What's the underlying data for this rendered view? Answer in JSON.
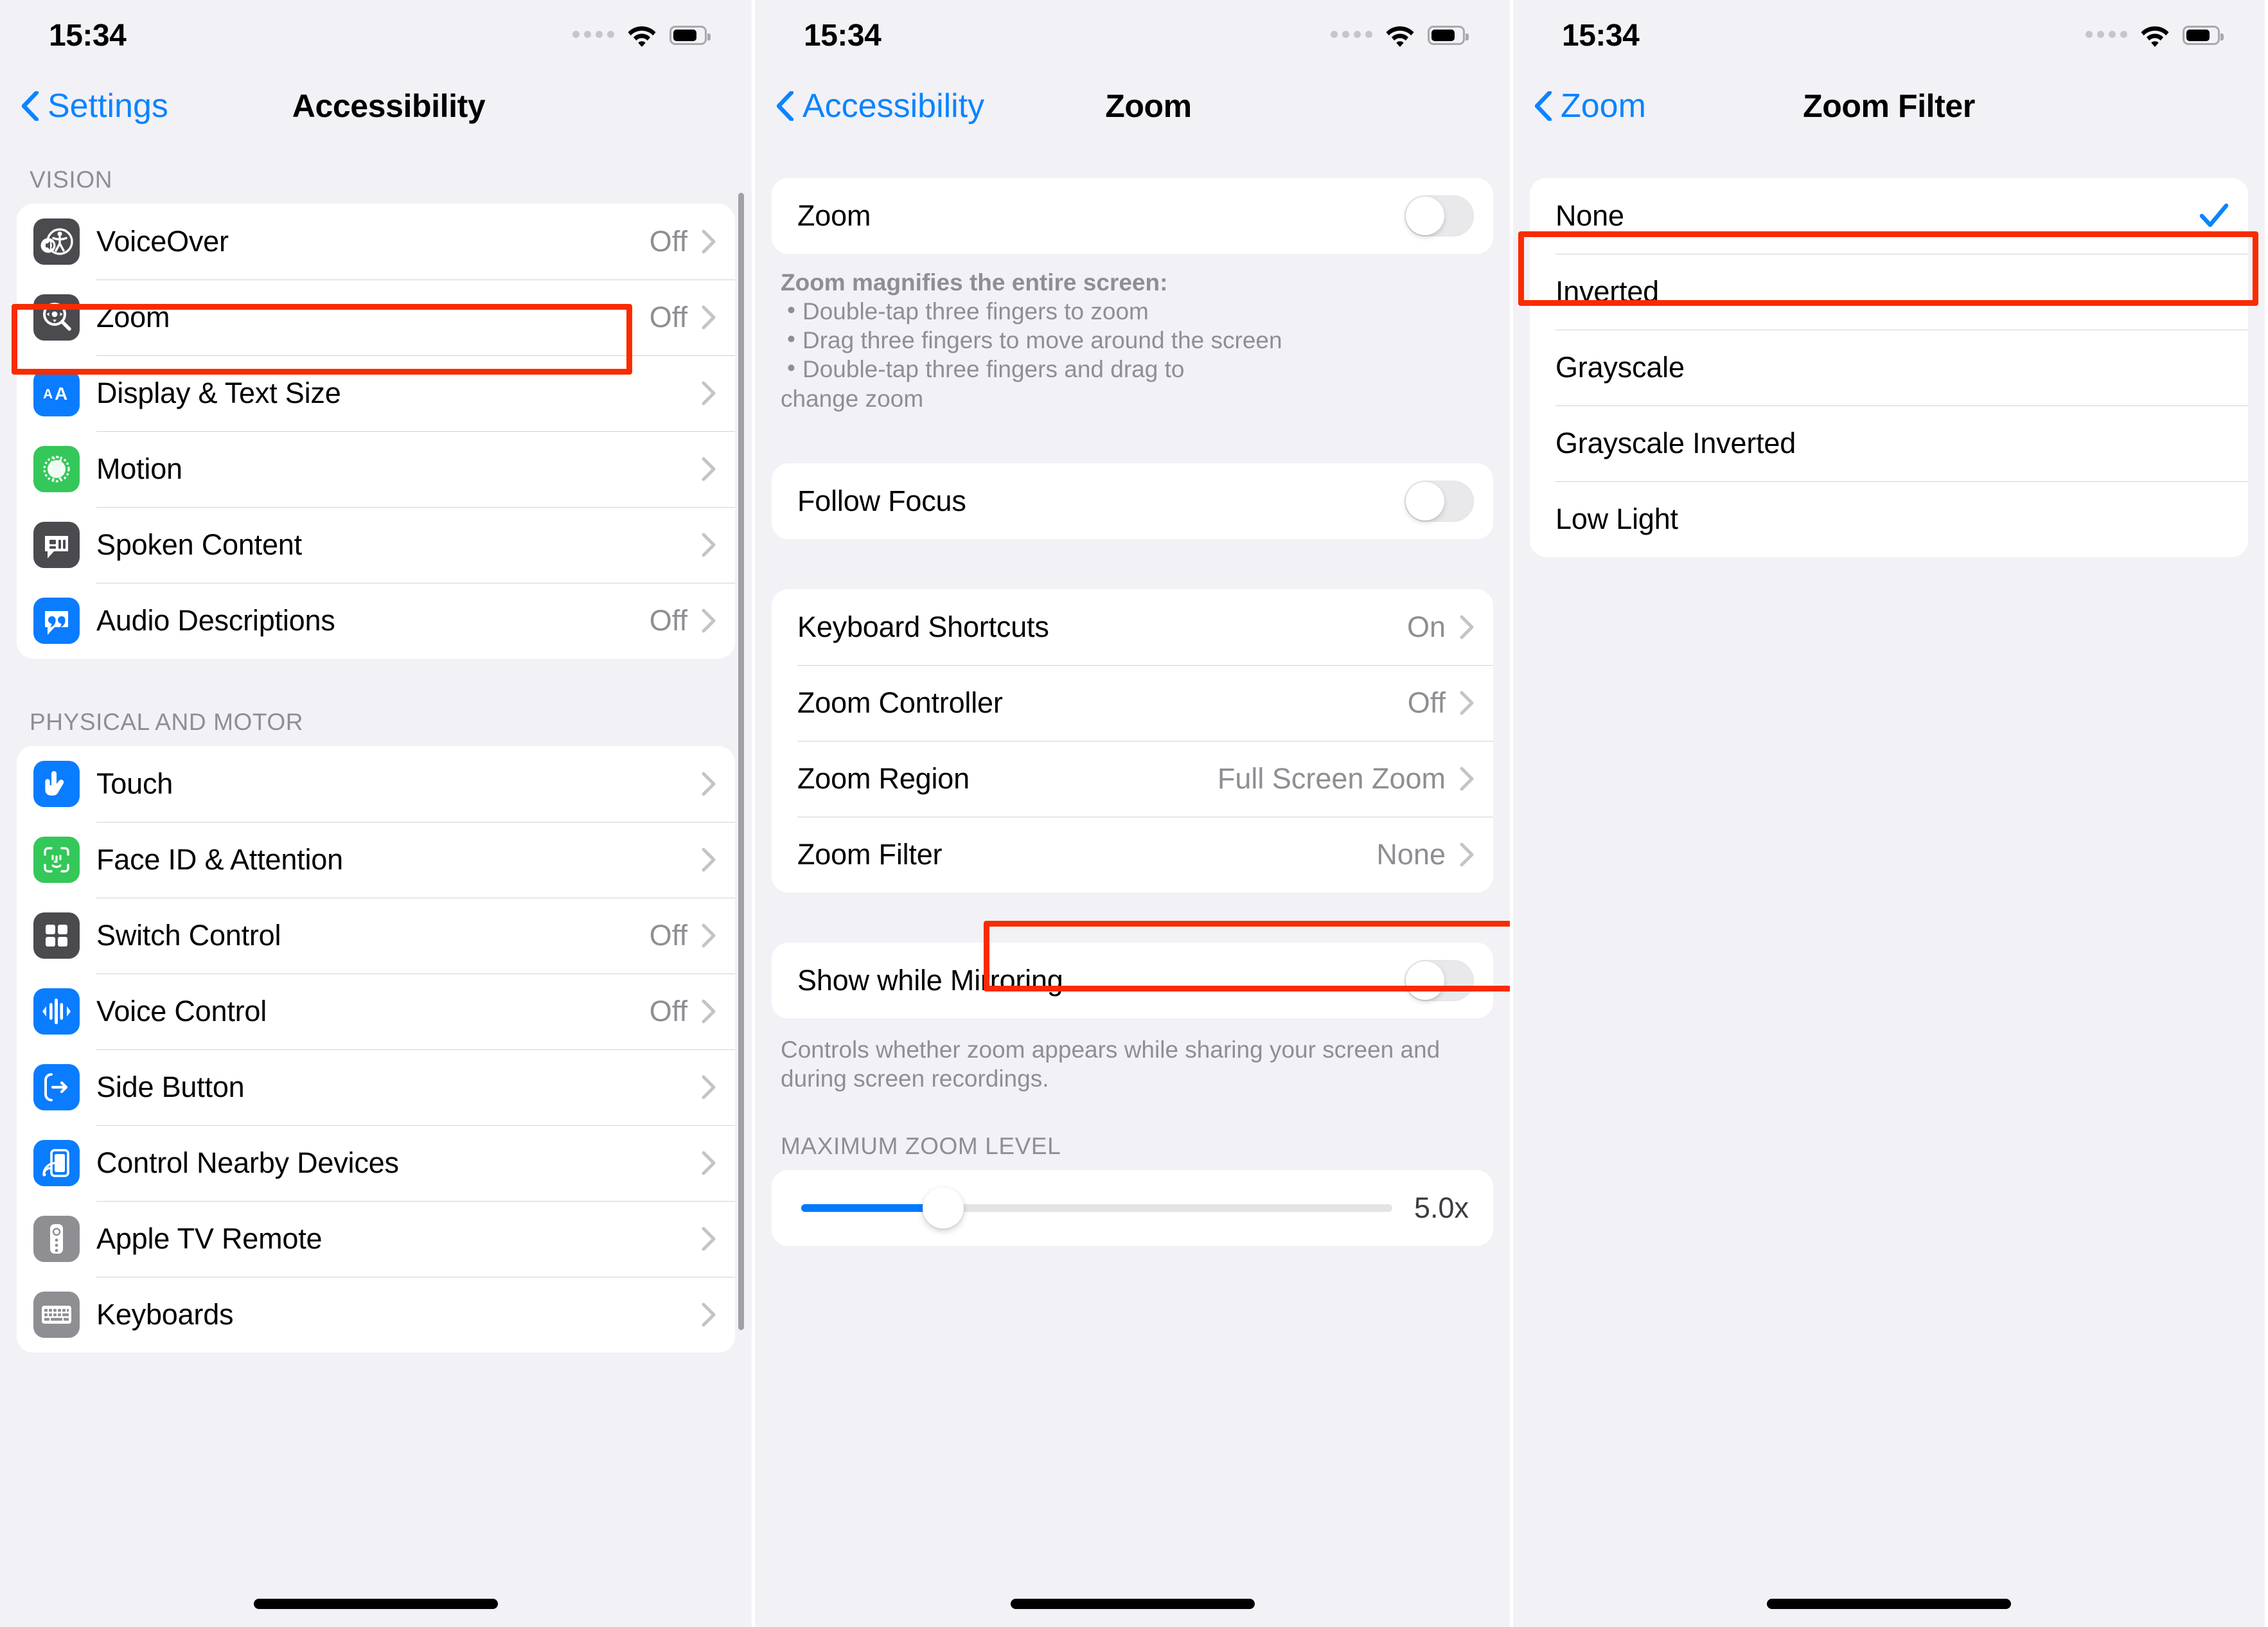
{
  "colors": {
    "accent_blue": "#0a84ff",
    "highlight_red": "#f92b00",
    "group_bg": "#f2f1f6",
    "card_bg": "#ffffff",
    "secondary_text": "#8e8e93",
    "slider_fill": "#007aff"
  },
  "status_bar": {
    "time": "15:34"
  },
  "panel1": {
    "nav": {
      "back_label": "Settings",
      "title": "Accessibility"
    },
    "sections": [
      {
        "header": "VISION",
        "rows": [
          {
            "label": "VoiceOver",
            "value": "Off",
            "icon": "voiceover-icon",
            "icon_bg": "#4a4a4f",
            "chevron": true
          },
          {
            "label": "Zoom",
            "value": "Off",
            "icon": "zoom-magnifier-icon",
            "icon_bg": "#4a4a4f",
            "chevron": true,
            "highlighted": true
          },
          {
            "label": "Display & Text Size",
            "value": "",
            "icon": "display-text-size-icon",
            "icon_bg": "#0a7cff",
            "chevron": true
          },
          {
            "label": "Motion",
            "value": "",
            "icon": "motion-icon",
            "icon_bg": "#34c759",
            "chevron": true
          },
          {
            "label": "Spoken Content",
            "value": "",
            "icon": "spoken-content-icon",
            "icon_bg": "#4a4a4f",
            "chevron": true
          },
          {
            "label": "Audio Descriptions",
            "value": "Off",
            "icon": "audio-descriptions-icon",
            "icon_bg": "#0a7cff",
            "chevron": true
          }
        ]
      },
      {
        "header": "PHYSICAL AND MOTOR",
        "rows": [
          {
            "label": "Touch",
            "value": "",
            "icon": "touch-hand-icon",
            "icon_bg": "#0a7cff",
            "chevron": true
          },
          {
            "label": "Face ID & Attention",
            "value": "",
            "icon": "face-id-icon",
            "icon_bg": "#34c759",
            "chevron": true
          },
          {
            "label": "Switch Control",
            "value": "Off",
            "icon": "switch-control-icon",
            "icon_bg": "#4a4a4f",
            "chevron": true
          },
          {
            "label": "Voice Control",
            "value": "Off",
            "icon": "voice-control-icon",
            "icon_bg": "#0a7cff",
            "chevron": true
          },
          {
            "label": "Side Button",
            "value": "",
            "icon": "side-button-icon",
            "icon_bg": "#0a7cff",
            "chevron": true
          },
          {
            "label": "Control Nearby Devices",
            "value": "",
            "icon": "control-nearby-devices-icon",
            "icon_bg": "#0a7cff",
            "chevron": true
          },
          {
            "label": "Apple TV Remote",
            "value": "",
            "icon": "apple-tv-remote-icon",
            "icon_bg": "#8e8e93",
            "chevron": true
          },
          {
            "label": "Keyboards",
            "value": "",
            "icon": "keyboards-icon",
            "icon_bg": "#8e8e93",
            "chevron": true
          }
        ]
      }
    ]
  },
  "panel2": {
    "nav": {
      "back_label": "Accessibility",
      "title": "Zoom"
    },
    "zoom_toggle": {
      "label": "Zoom",
      "state": "off"
    },
    "zoom_footnote": {
      "heading": "Zoom magnifies the entire screen:",
      "bullets": [
        "Double-tap three fingers to zoom",
        "Drag three fingers to move around the screen",
        "Double-tap three fingers and drag to"
      ],
      "tail": "change zoom"
    },
    "follow_focus": {
      "label": "Follow Focus",
      "state": "off"
    },
    "options": [
      {
        "label": "Keyboard Shortcuts",
        "value": "On"
      },
      {
        "label": "Zoom Controller",
        "value": "Off"
      },
      {
        "label": "Zoom Region",
        "value": "Full Screen Zoom"
      },
      {
        "label": "Zoom Filter",
        "value": "None",
        "highlighted": true
      }
    ],
    "mirroring": {
      "label": "Show while Mirroring",
      "state": "off"
    },
    "mirroring_footnote": "Controls whether zoom appears while sharing your screen and during screen recordings.",
    "max_zoom": {
      "header": "MAXIMUM ZOOM LEVEL",
      "value": "5.0x",
      "percent": 24
    }
  },
  "panel3": {
    "nav": {
      "back_label": "Zoom",
      "title": "Zoom Filter"
    },
    "filters": [
      {
        "label": "None",
        "selected": true,
        "highlighted": true
      },
      {
        "label": "Inverted",
        "selected": false
      },
      {
        "label": "Grayscale",
        "selected": false
      },
      {
        "label": "Grayscale Inverted",
        "selected": false
      },
      {
        "label": "Low Light",
        "selected": false
      }
    ]
  }
}
